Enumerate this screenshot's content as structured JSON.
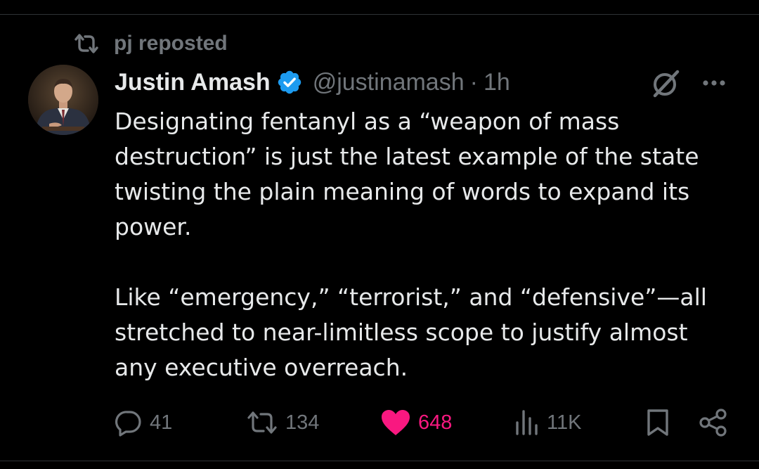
{
  "repost": {
    "icon": "repost-icon",
    "label": "pj reposted"
  },
  "tweet": {
    "author": {
      "display_name": "Justin Amash",
      "verified": true,
      "verified_color": "#1d9bf0",
      "handle": "@justinamash",
      "separator": "·",
      "time": "1h",
      "avatar": "avatar-photo"
    },
    "paragraphs": [
      "Designating fentanyl as a “weapon of mass destruction” is just the latest example of the state twisting the plain meaning of words to expand its power.",
      "Like “emergency,” “terrorist,” and “defensive”—all stretched to near-limitless scope to justify almost any executive overreach."
    ],
    "header_icons": [
      "grok-icon",
      "more-icon"
    ]
  },
  "actions": {
    "replies": "41",
    "reposts": "134",
    "likes": "648",
    "views": "11K",
    "liked": true,
    "like_color": "#f91880",
    "icons": [
      "reply-icon",
      "repost-icon",
      "heart-icon",
      "views-icon",
      "bookmark-icon",
      "share-icon"
    ]
  },
  "colors": {
    "background": "#000000",
    "text": "#e7e9ea",
    "secondary": "#71767b",
    "divider": "#2f3336"
  }
}
